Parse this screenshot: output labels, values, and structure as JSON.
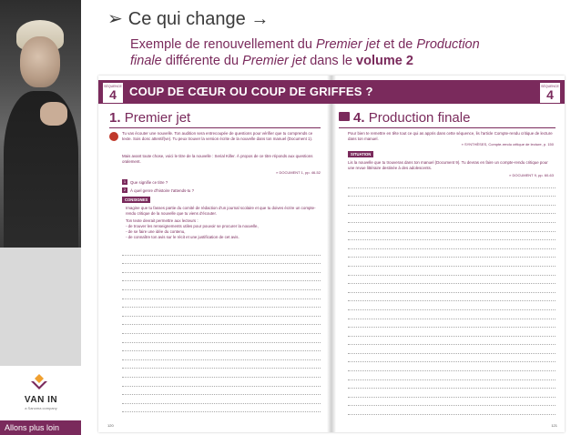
{
  "slide": {
    "heading": "Ce qui change",
    "subtitle_parts": {
      "p1": "Exemple de renouvellement du ",
      "p2": "Premier jet",
      "p3": " et de ",
      "p4": "Production",
      "p5": "finale",
      "p6": " différente du ",
      "p7": "Premier jet",
      "p8": " dans le ",
      "p9": "volume 2"
    }
  },
  "sidebar": {
    "logo_text": "VAN IN",
    "logo_sub": "a Sanoma company",
    "tagline": "Allons plus loin"
  },
  "book": {
    "seq_label": "SÉQUENCE",
    "seq_number": "4",
    "title": "COUP DE CŒUR OU COUP DE GRIFFES ?",
    "left": {
      "section_number": "1.",
      "section_title": "Premier jet",
      "intro": "Tu vas écouter une nouvelle. Ton audition sera entrecoupée de questions pour vérifier que tu comprends ce texte. Sois donc attentif(ve). Tu peux trouver la version écrite de la nouvelle dans ton manuel (Document 1).",
      "intro2": "Mais avant toute chose, voici le titre de la nouvelle : Serial Killer. À propos de ce titre réponds aux questions oralement.",
      "ref1": "» DOCUMENT 1, pp. 46-52",
      "q1_num": "1",
      "q1": "Que signifie ce titre ?",
      "q2_num": "2",
      "q2": "À quel genre d'histoire t'attends-tu ?",
      "consignes_label": "CONSIGNES",
      "c1": "Imagine que tu fasses partie du comité de rédaction d'un journal scolaire et que tu doives écrire un compte-rendu critique de la nouvelle que tu viens d'écouter.",
      "c2": "Ton texte devrait permettre aux lecteurs :",
      "c3": "- de trouver les renseignements utiles pour pouvoir se procurer la nouvelle,",
      "c4": "- de se faire une idée du contenu,",
      "c5": "- de connaître ton avis sur le récit et une justification de cet avis.",
      "page_number": "120"
    },
    "right": {
      "section_number": "4.",
      "section_title": "Production finale",
      "intro": "Pour bien te remettre en tête tout ce qui as appris dans cette séquence, lis l'article Compte-rendu critique de lecture dans ton manuel.",
      "ref1": "» SYNTHÈSES, Compte-rendu critique de lecture, p. 150",
      "situation_label": "SITUATION",
      "situation": "Lis la nouvelle que tu trouveras dans ton manuel (Document 9). Tu devras en faire un compte-rendu critique pour une revue littéraire destinée à des adolescents.",
      "ref2": "» DOCUMENT 9, pp. 60-63",
      "page_number": "121"
    }
  },
  "colors": {
    "accent": "#7a2a5c",
    "sidebar_grey": "#d9d9d9",
    "heading": "#3a3a3a"
  },
  "icons": {
    "heading_bullet": "arrow-bullet-icon",
    "heading_arrow": "right-arrow-icon",
    "logo": "van-in-logo-icon",
    "left_section": "ear-listening-icon",
    "right_section": "book-icon"
  }
}
